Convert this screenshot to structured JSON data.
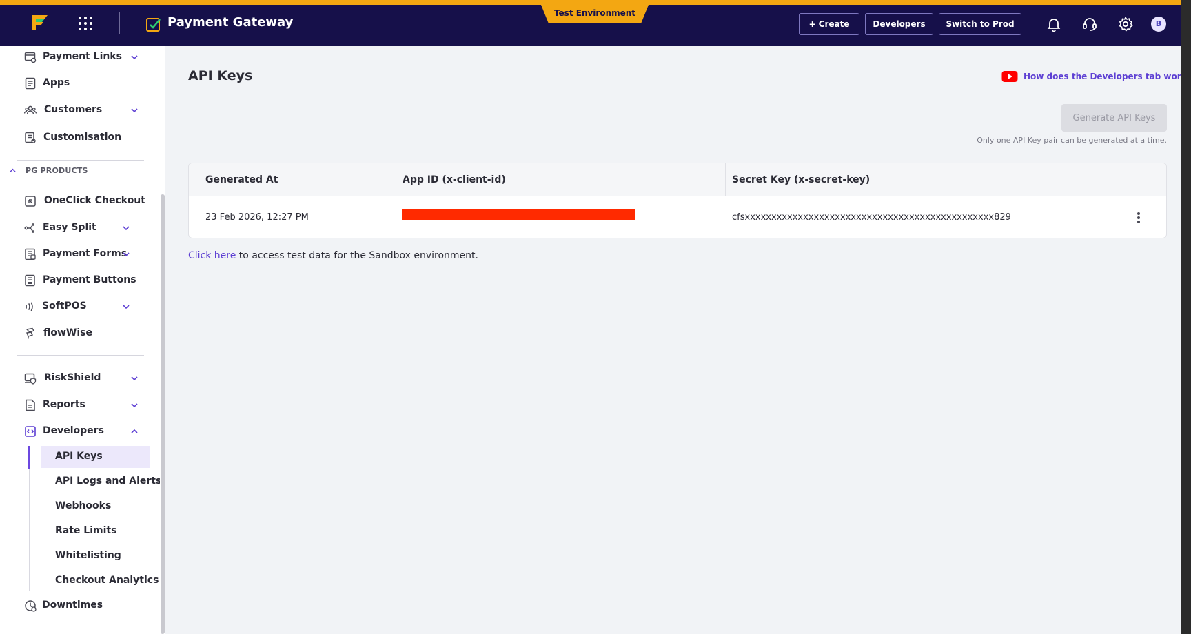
{
  "header": {
    "app_title": "Payment Gateway",
    "environment_badge": "Test Environment",
    "create_label": "+ Create",
    "developers_label": "Developers",
    "switch_label": "Switch to Prod",
    "avatar_initial": "B",
    "icons": [
      "logo-icon",
      "apps-grid-icon",
      "payment-gateway-icon",
      "bell-icon",
      "headset-icon",
      "gear-icon"
    ]
  },
  "sidebar": {
    "items_top": [
      {
        "label": "Payment Links",
        "icon": "link-card-icon",
        "expandable": true
      },
      {
        "label": "Apps",
        "icon": "apps-doc-icon",
        "expandable": false
      },
      {
        "label": "Customers",
        "icon": "customers-icon",
        "expandable": true
      },
      {
        "label": "Customisation",
        "icon": "customisation-icon",
        "expandable": false
      }
    ],
    "section_title": "PG PRODUCTS",
    "pg_products": [
      {
        "label": "OneClick Checkout",
        "icon": "oneclick-icon",
        "expandable": false
      },
      {
        "label": "Easy Split",
        "icon": "split-icon",
        "expandable": true
      },
      {
        "label": "Payment Forms",
        "icon": "form-icon",
        "expandable": true
      },
      {
        "label": "Payment Buttons",
        "icon": "button-icon",
        "expandable": false
      },
      {
        "label": "SoftPOS",
        "icon": "contactless-icon",
        "expandable": true
      },
      {
        "label": "flowWise",
        "icon": "flowwise-icon",
        "expandable": false
      }
    ],
    "items_bottom": [
      {
        "label": "RiskShield",
        "icon": "shield-icon",
        "expandable": true
      },
      {
        "label": "Reports",
        "icon": "report-icon",
        "expandable": true
      },
      {
        "label": "Developers",
        "icon": "code-icon",
        "expandable": true,
        "expanded": true
      }
    ],
    "developer_subitems": [
      "API Keys",
      "API Logs and Alerts",
      "Webhooks",
      "Rate Limits",
      "Whitelisting",
      "Checkout Analytics"
    ],
    "active_subitem": "API Keys",
    "downtimes_label": "Downtimes"
  },
  "main": {
    "page_title": "API Keys",
    "help_link": "How does the Developers tab work?",
    "generate_button": "Generate API Keys",
    "generate_note": "Only one API Key pair can be generated at a time.",
    "table": {
      "columns": [
        "Generated At",
        "App ID (x-client-id)",
        "Secret Key (x-secret-key)",
        ""
      ],
      "rows": [
        {
          "generated_at": "23 Feb 2026, 12:27 PM",
          "app_id": "",
          "secret_key": "cfsxxxxxxxxxxxxxxxxxxxxxxxxxxxxxxxxxxxxxxxxxxxxxxx829"
        }
      ]
    },
    "sandbox_link": "Click here",
    "sandbox_text": " to access test data for the Sandbox environment."
  },
  "colors": {
    "topbar": "#16104a",
    "accent": "#f3a712",
    "link": "#5d3fd3",
    "redaction": "#ff2a00"
  }
}
